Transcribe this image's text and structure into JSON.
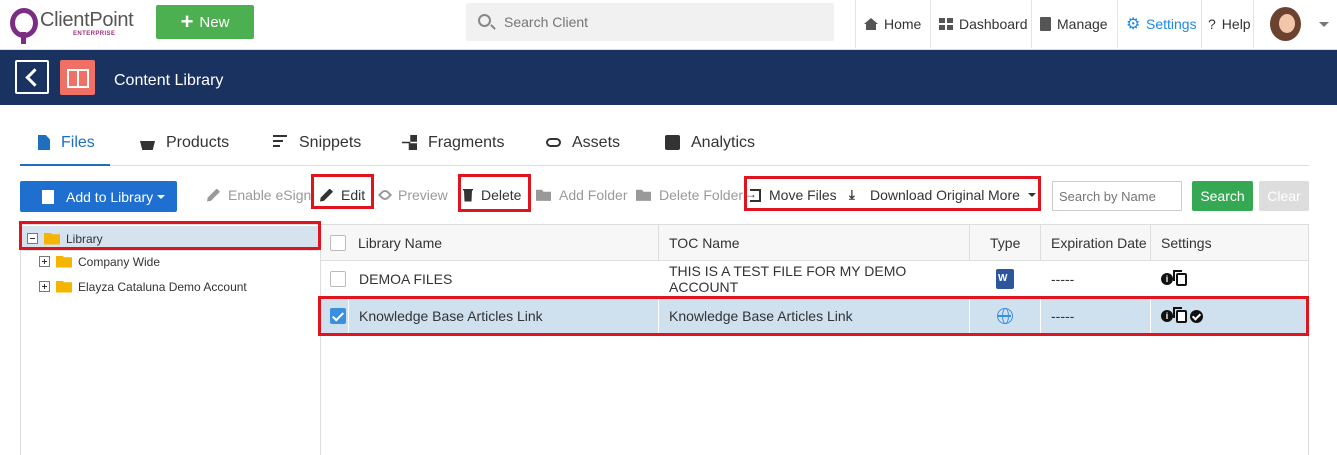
{
  "app": {
    "brand": "ClientPoint",
    "brand_sub": "ENTERPRISE",
    "new_label": "New",
    "search_placeholder": "Search Client",
    "nav": {
      "home": "Home",
      "dashboard": "Dashboard",
      "manage": "Manage",
      "settings": "Settings",
      "help": "Help"
    }
  },
  "header": {
    "title": "Content Library"
  },
  "tabs": [
    {
      "label": "Files",
      "active": true
    },
    {
      "label": "Products"
    },
    {
      "label": "Snippets"
    },
    {
      "label": "Fragments"
    },
    {
      "label": "Assets"
    },
    {
      "label": "Analytics"
    }
  ],
  "toolbar": {
    "add_library": "Add to Library",
    "enable_esign": "Enable eSign",
    "edit": "Edit",
    "preview": "Preview",
    "delete": "Delete",
    "add_folder": "Add Folder",
    "delete_folder": "Delete Folder",
    "move_files": "Move Files",
    "download_original": "Download Original",
    "more": "More",
    "search_placeholder": "Search by Name",
    "search": "Search",
    "clear": "Clear"
  },
  "tree": {
    "root": "Library",
    "children": [
      "Company Wide",
      "Elayza Cataluna Demo Account"
    ]
  },
  "table": {
    "columns": [
      "Library Name",
      "TOC Name",
      "Type",
      "Expiration Date",
      "Settings"
    ],
    "rows": [
      {
        "name": "DEMOA FILES",
        "toc": "THIS IS A TEST FILE FOR MY DEMO ACCOUNT",
        "type": "word",
        "expiration": "-----",
        "checked": false
      },
      {
        "name": "Knowledge Base Articles Link",
        "toc": "Knowledge Base Articles Link",
        "type": "web-link",
        "expiration": "-----",
        "checked": true
      }
    ]
  },
  "colors": {
    "header_bg": "#1a3260",
    "accent": "#1e6fbf",
    "new_button": "#4caf50",
    "highlight": "#e0141f"
  }
}
